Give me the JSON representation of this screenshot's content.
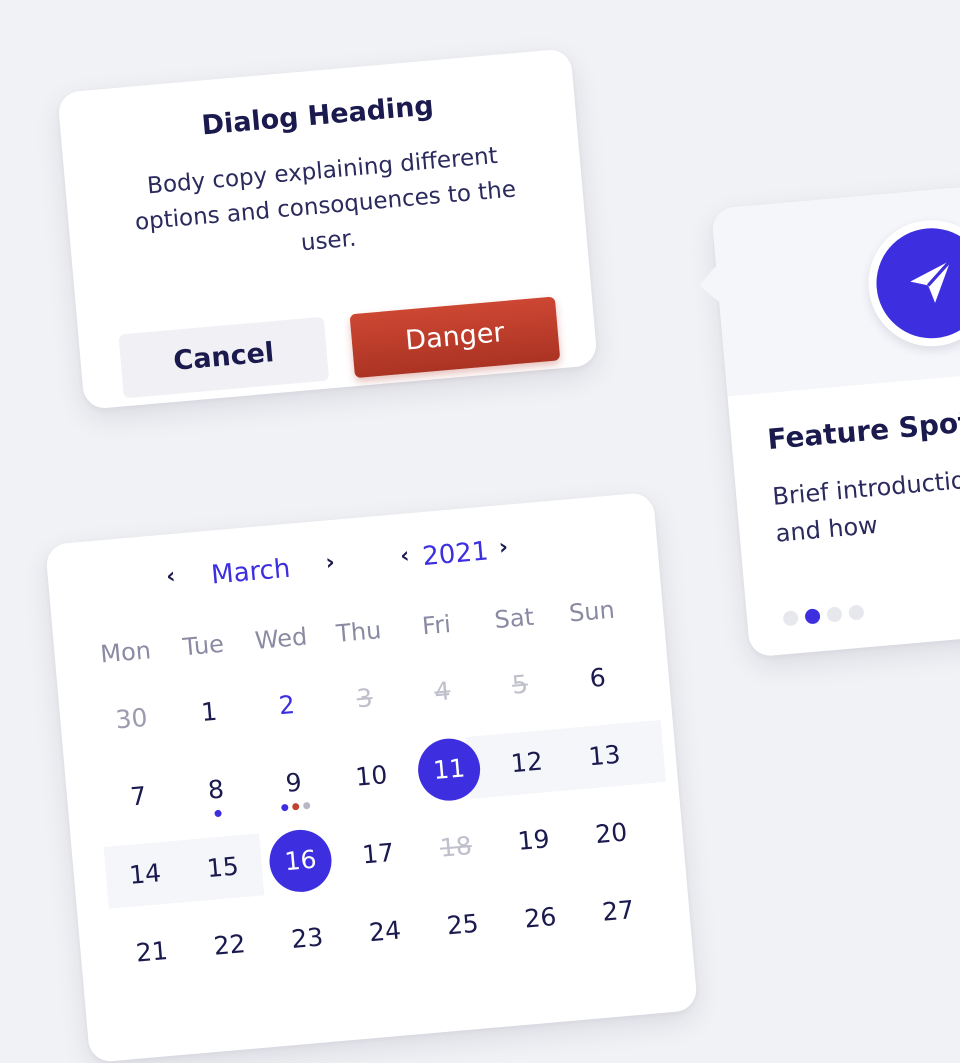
{
  "dialog": {
    "heading": "Dialog Heading",
    "body": "Body copy explaining different options and consoquences to the user.",
    "cancel_label": "Cancel",
    "danger_label": "Danger"
  },
  "spotlight": {
    "title": "Feature Spotlight",
    "description": "Brief introduction to the feature and how",
    "icon": "send-icon",
    "pages": 4,
    "active_page": 2
  },
  "calendar": {
    "month": "March",
    "year": "2021",
    "weekdays": [
      "Mon",
      "Tue",
      "Wed",
      "Thu",
      "Fri",
      "Sat",
      "Sun"
    ],
    "weeks": [
      [
        {
          "d": "30",
          "state": "muted"
        },
        {
          "d": "1"
        },
        {
          "d": "2",
          "state": "highlight"
        },
        {
          "d": "3",
          "state": "disabled"
        },
        {
          "d": "4",
          "state": "disabled"
        },
        {
          "d": "5",
          "state": "disabled"
        },
        {
          "d": "6"
        }
      ],
      [
        {
          "d": "7"
        },
        {
          "d": "8",
          "events": [
            "#3d2fe0"
          ]
        },
        {
          "d": "9",
          "events": [
            "#3d2fe0",
            "#c0432f",
            "#b8b8c4"
          ]
        },
        {
          "d": "10"
        },
        {
          "d": "11",
          "state": "selected"
        },
        {
          "d": "12",
          "range": true
        },
        {
          "d": "13",
          "range": true
        }
      ],
      [
        {
          "d": "14",
          "range": true
        },
        {
          "d": "15",
          "range": true
        },
        {
          "d": "16",
          "state": "selected"
        },
        {
          "d": "17"
        },
        {
          "d": "18",
          "state": "disabled"
        },
        {
          "d": "19"
        },
        {
          "d": "20"
        }
      ],
      [
        {
          "d": "21"
        },
        {
          "d": "22"
        },
        {
          "d": "23"
        },
        {
          "d": "24"
        },
        {
          "d": "25"
        },
        {
          "d": "26"
        },
        {
          "d": "27"
        }
      ]
    ]
  },
  "colors": {
    "accent": "#3d2fe0",
    "danger": "#c0432f",
    "text": "#1b1a4e",
    "background": "#f1f2f5"
  }
}
